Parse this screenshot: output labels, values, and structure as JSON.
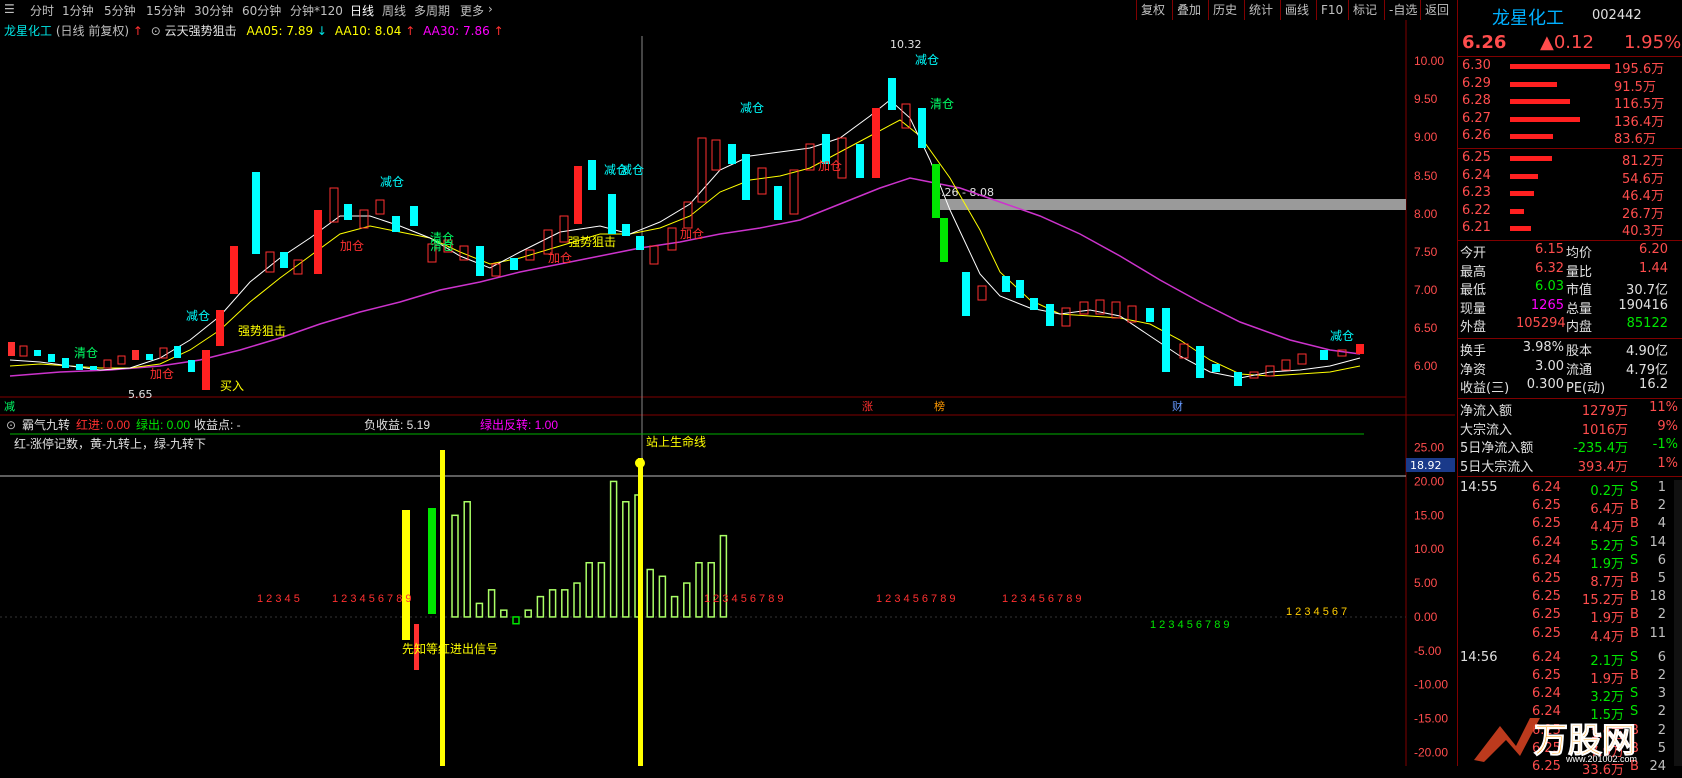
{
  "toolbar": {
    "period_buttons": [
      "分时",
      "1分钟",
      "5分钟",
      "15分钟",
      "30分钟",
      "60分钟",
      "分钟*120",
      "日线",
      "周线",
      "多周期",
      "更多"
    ],
    "right_buttons": [
      "复权",
      "叠加",
      "历史",
      "统计",
      "画线",
      "F10",
      "标记",
      "-自选",
      "返回"
    ]
  },
  "header": {
    "stock_name": "龙星化工",
    "mode": "(日线 前复权)",
    "indicator_name": "云天强势狙击",
    "aa05": "AA05: 7.89",
    "aa10": "AA10: 8.04",
    "aa30": "AA30: 7.86"
  },
  "price_axis": [
    "10.00",
    "9.50",
    "9.00",
    "8.50",
    "8.00",
    "7.50",
    "7.00",
    "6.50",
    "6.00"
  ],
  "price_label_range": "8.26 - 8.08",
  "chart_annotations": {
    "high": "10.32",
    "low": "5.65",
    "signals": [
      "清仓",
      "减仓",
      "加仓",
      "买入",
      "强势狙击",
      "清仓",
      "减仓",
      "加仓",
      "减仓",
      "加仓",
      "减仓",
      "清仓",
      "加仓",
      "强势狙击",
      "清仓",
      "减仓",
      "加仓",
      "减仓",
      "减仓",
      "清仓",
      "减仓"
    ],
    "bottom_tags": [
      "减",
      "涨",
      "榜",
      "财"
    ]
  },
  "chart_data": {
    "type": "bar",
    "title": "霸气九转",
    "indicator_header": {
      "name": "霸气九转",
      "red_in": "红进: 0.00",
      "green_out": "绿出: 0.00",
      "profit_point": "收益点: -",
      "neg_profit": "负收益: 5.19",
      "green_reverse": "绿出反转: 1.00"
    },
    "legend_note": "红-涨停记数，黄-九转上，绿-九转下",
    "signal_text": "先知等红进出信号",
    "life_line_text": "站上生命线",
    "current_value": "18.92",
    "ylim": [
      -22,
      27
    ],
    "y_ticks": [
      "25.00",
      "20.00",
      "15.00",
      "10.00",
      "5.00",
      "0.00",
      "-5.00",
      "-10.00",
      "-15.00",
      "-20.00"
    ],
    "sequences": [
      "1 2 3 4 5",
      "1 2 3 4 5 6 7 8 9",
      "1 2 3 4 5 6 7 8 9",
      "1 2 3 4 5 6 7 8 9",
      "1 2 3 4 5 6 7 8 9",
      "1 2 3 4 5 6 7 8 9",
      "1 2 3 4 5 6 7 8 9",
      "1 2 3 4 5 6 7"
    ],
    "values": [
      15,
      17,
      2,
      4,
      1,
      -1,
      1,
      3,
      4,
      4,
      5,
      8,
      8,
      20,
      17,
      18,
      7,
      6,
      3,
      5,
      8,
      8,
      12
    ]
  },
  "quote": {
    "name": "龙星化工",
    "code": "002442",
    "price": "6.26",
    "change": "▲0.12",
    "pct": "1.95%",
    "asks": [
      {
        "p": "6.30",
        "v": "195.6万"
      },
      {
        "p": "6.29",
        "v": "91.5万"
      },
      {
        "p": "6.28",
        "v": "116.5万"
      },
      {
        "p": "6.27",
        "v": "136.4万"
      },
      {
        "p": "6.26",
        "v": "83.6万"
      }
    ],
    "bids": [
      {
        "p": "6.25",
        "v": "81.2万"
      },
      {
        "p": "6.24",
        "v": "54.6万"
      },
      {
        "p": "6.23",
        "v": "46.4万"
      },
      {
        "p": "6.22",
        "v": "26.7万"
      },
      {
        "p": "6.21",
        "v": "40.3万"
      }
    ],
    "stats": [
      {
        "k1": "今开",
        "v1": "6.15",
        "k2": "均价",
        "v2": "6.20"
      },
      {
        "k1": "最高",
        "v1": "6.32",
        "k2": "量比",
        "v2": "1.44"
      },
      {
        "k1": "最低",
        "v1": "6.03",
        "k2": "市值",
        "v2": "30.7亿"
      },
      {
        "k1": "现量",
        "v1": "1265",
        "k2": "总量",
        "v2": "190416"
      },
      {
        "k1": "外盘",
        "v1": "105294",
        "k2": "内盘",
        "v2": "85122"
      }
    ],
    "stats2": [
      {
        "k1": "换手",
        "v1": "3.98%",
        "k2": "股本",
        "v2": "4.90亿"
      },
      {
        "k1": "净资",
        "v1": "3.00",
        "k2": "流通",
        "v2": "4.79亿"
      },
      {
        "k1": "收益(三)",
        "v1": "0.300",
        "k2": "PE(动)",
        "v2": "16.2"
      }
    ],
    "flows": [
      {
        "k": "净流入额",
        "v": "1279万",
        "p": "11%"
      },
      {
        "k": "大宗流入",
        "v": "1016万",
        "p": "9%"
      },
      {
        "k": "5日净流入额",
        "v": "-235.4万",
        "p": "-1%"
      },
      {
        "k": "5日大宗流入",
        "v": "393.4万",
        "p": "1%"
      }
    ],
    "ticks": [
      {
        "t": "14:55",
        "p": "6.24",
        "v": "0.2万",
        "d": "S",
        "n": "1"
      },
      {
        "t": "",
        "p": "6.25",
        "v": "6.4万",
        "d": "B",
        "n": "2"
      },
      {
        "t": "",
        "p": "6.25",
        "v": "4.4万",
        "d": "B",
        "n": "4"
      },
      {
        "t": "",
        "p": "6.24",
        "v": "5.2万",
        "d": "S",
        "n": "14"
      },
      {
        "t": "",
        "p": "6.24",
        "v": "1.9万",
        "d": "S",
        "n": "6"
      },
      {
        "t": "",
        "p": "6.25",
        "v": "8.7万",
        "d": "B",
        "n": "5"
      },
      {
        "t": "",
        "p": "6.25",
        "v": "15.2万",
        "d": "B",
        "n": "18"
      },
      {
        "t": "",
        "p": "6.25",
        "v": "1.9万",
        "d": "B",
        "n": "2"
      },
      {
        "t": "",
        "p": "6.25",
        "v": "4.4万",
        "d": "B",
        "n": "11"
      },
      {
        "t": "14:56",
        "p": "6.24",
        "v": "2.1万",
        "d": "S",
        "n": "6"
      },
      {
        "t": "",
        "p": "6.25",
        "v": "1.9万",
        "d": "B",
        "n": "2"
      },
      {
        "t": "",
        "p": "6.24",
        "v": "3.2万",
        "d": "S",
        "n": "3"
      },
      {
        "t": "",
        "p": "6.24",
        "v": "1.5万",
        "d": "S",
        "n": "2"
      },
      {
        "t": "",
        "p": "6.25",
        "v": "1.9万",
        "d": "B",
        "n": "2"
      },
      {
        "t": "",
        "p": "6.25",
        "v": "7.9万",
        "d": "B",
        "n": "5"
      },
      {
        "t": "",
        "p": "6.25",
        "v": "33.6万",
        "d": "B",
        "n": "24"
      }
    ],
    "watermark": "万股网",
    "watermark_url": "www.201002.com"
  }
}
